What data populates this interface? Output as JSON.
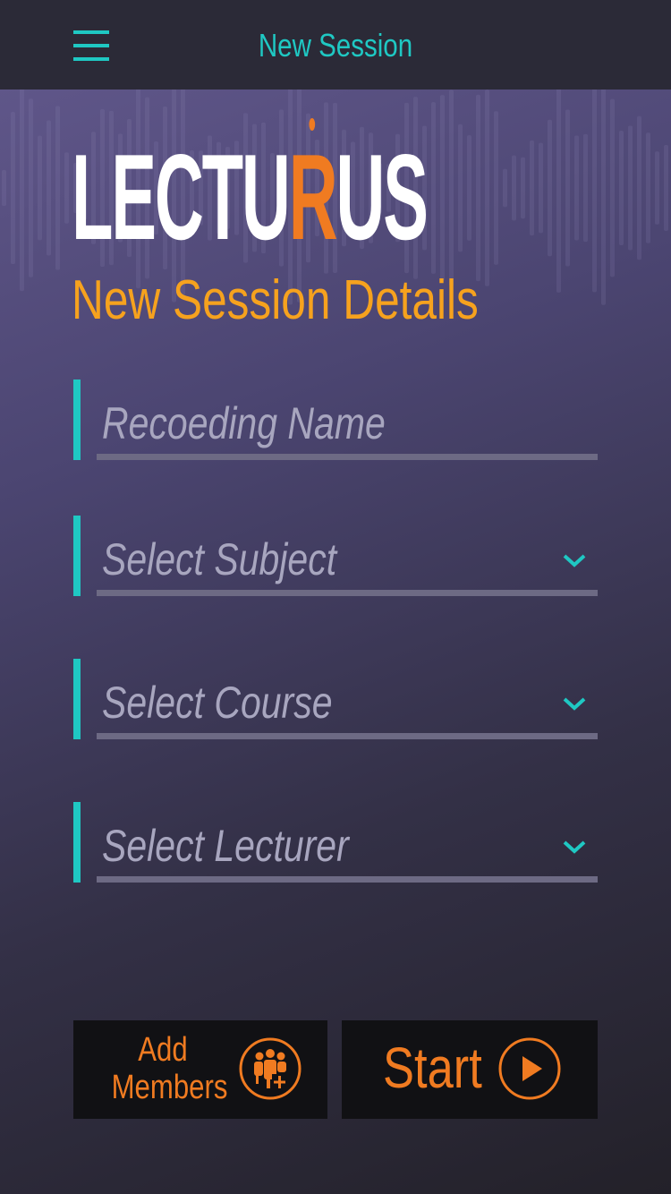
{
  "header": {
    "title": "New Session",
    "menu_icon": "hamburger-menu-icon"
  },
  "logo": {
    "prefix": "LECTU",
    "highlight": "R",
    "suffix": "US"
  },
  "form": {
    "heading": "New Session Details",
    "fields": [
      {
        "label": "Recoeding Name",
        "type": "text"
      },
      {
        "label": "Select Subject",
        "type": "select"
      },
      {
        "label": "Select Course",
        "type": "select"
      },
      {
        "label": "Select Lecturer",
        "type": "select"
      }
    ]
  },
  "actions": {
    "add_members_line1": "Add",
    "add_members_line2": "Members",
    "add_members_icon": "add-group-icon",
    "start_label": "Start",
    "start_icon": "play-icon"
  },
  "colors": {
    "accent_teal": "#1fc8c3",
    "accent_orange": "#f07b21",
    "heading_orange": "#f6a21e"
  }
}
